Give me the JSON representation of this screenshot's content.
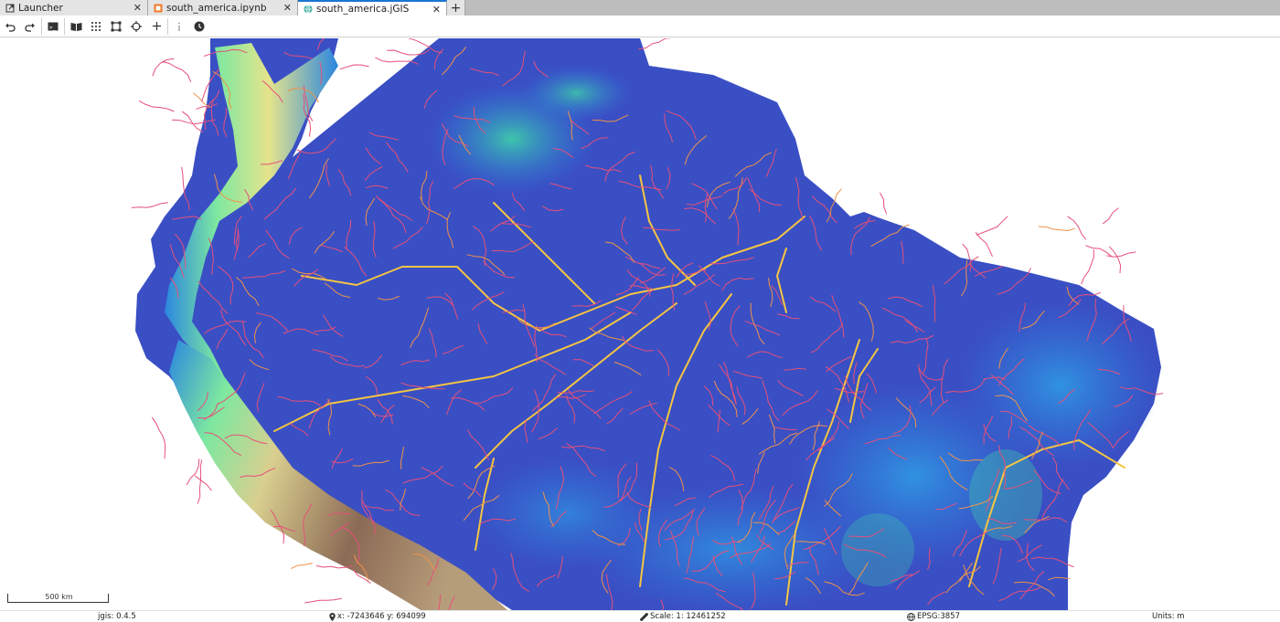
{
  "tabs": [
    {
      "label": "Launcher",
      "icon": "launcher-icon",
      "active": false
    },
    {
      "label": "south_america.ipynb",
      "icon": "notebook-icon",
      "active": false
    },
    {
      "label": "south_america.jGIS",
      "icon": "globe-icon",
      "active": true
    }
  ],
  "toolbar": {
    "buttons": [
      "undo-icon",
      "redo-icon",
      "terminal-icon",
      "book-icon",
      "grid-icon",
      "vector-shape-icon",
      "crosshair-icon",
      "plus-icon",
      "info-icon",
      "history-icon"
    ]
  },
  "map": {
    "description_layers": [
      "elevation-colormap",
      "river-network"
    ],
    "colors": {
      "lowland": "#3a4fc4",
      "mid": "#2a86e0",
      "upland": "#7de8a0",
      "highland": "#e6e48c",
      "peak": "#8c6a55",
      "river_major": "#f5c542",
      "river_minor": "#e6507a"
    }
  },
  "scalebar": {
    "label": "500 km"
  },
  "status": {
    "version": "jgis: 0.4.5",
    "coords": "x: -7243646 y: 694099",
    "scale": "Scale: 1: 12461252",
    "crs": "EPSG:3857",
    "units": "Units: m"
  }
}
